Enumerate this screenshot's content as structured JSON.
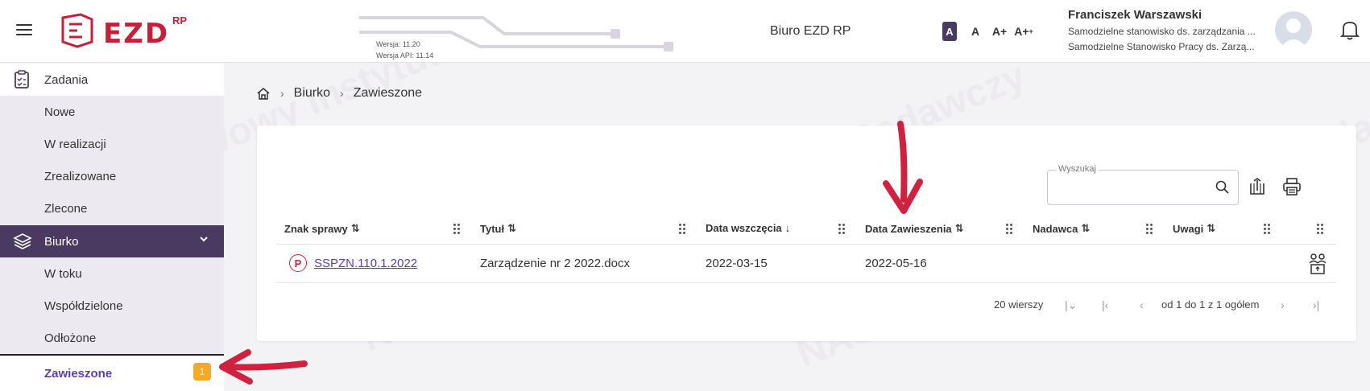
{
  "header": {
    "logo_text": "EZD",
    "logo_sup": "RP",
    "version": "Wersja: 11.20",
    "api_version": "Wersja API: 11.14",
    "office_name": "Biuro EZD RP",
    "font_sizes": [
      "A",
      "A",
      "A+",
      "A+"
    ],
    "user": {
      "name": "Franciszek Warszawski",
      "position1": "Samodzielne stanowisko ds. zarządzania ...",
      "position2": "Samodzielne Stanowisko Pracy ds. Zarzą..."
    }
  },
  "sidebar": {
    "items": [
      {
        "label": "Zadania",
        "icon": "clipboard-check-icon"
      },
      {
        "label": "Nowe"
      },
      {
        "label": "W realizacji"
      },
      {
        "label": "Zrealizowane"
      },
      {
        "label": "Zlecone"
      },
      {
        "label": "Biurko",
        "icon": "layers-icon"
      },
      {
        "label": "W toku"
      },
      {
        "label": "Współdzielone"
      },
      {
        "label": "Odłożone"
      },
      {
        "label": "Zawieszone",
        "badge": "1"
      }
    ]
  },
  "breadcrumb": {
    "items": [
      "Biurko",
      "Zawieszone"
    ]
  },
  "search": {
    "label": "Wyszukaj",
    "value": ""
  },
  "table": {
    "columns": [
      "Znak sprawy",
      "Tytuł",
      "Data wszczęcia",
      "Data Zawieszenia",
      "Nadawca",
      "Uwagi"
    ],
    "rows": [
      {
        "marker": "P",
        "case_no": "SSPZN.110.1.2022",
        "title": "Zarządzenie nr 2 2022.docx",
        "start_date": "2022-03-15",
        "suspend_date": "2022-05-16",
        "sender": "",
        "notes": ""
      }
    ]
  },
  "pagination": {
    "rows_per_page": "20 wierszy",
    "range": "od 1 do 1 z 1 ogółem"
  },
  "watermark": "NASK – Państwowy Instytut Badawczy",
  "colors": {
    "primary": "#4a3a62",
    "accent_red": "#c71f3a",
    "link": "#5b3fb0",
    "badge": "#f3a92a"
  }
}
